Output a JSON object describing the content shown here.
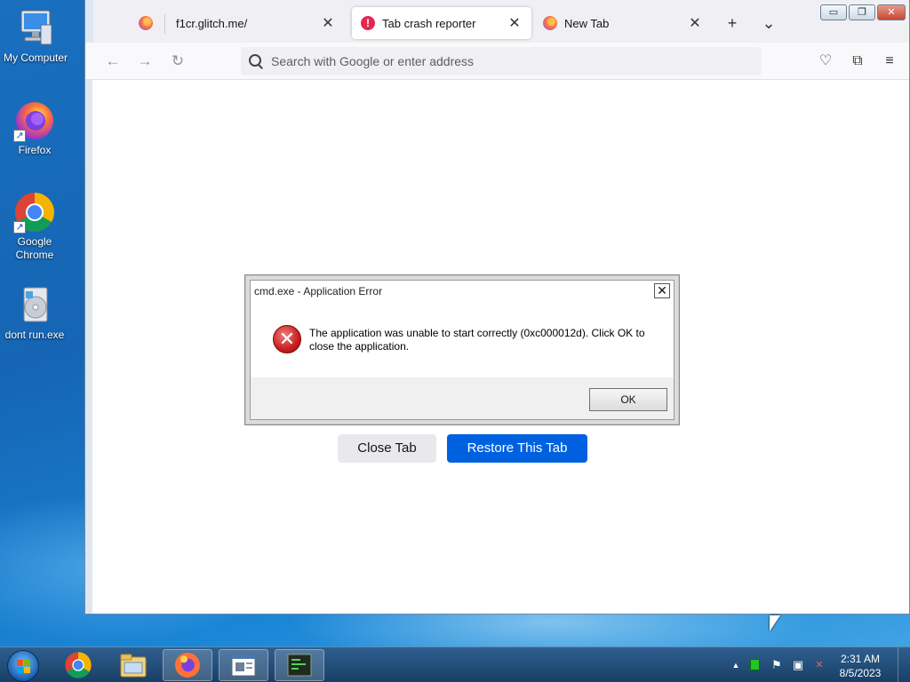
{
  "desktop": {
    "icons": [
      {
        "label": "My Computer",
        "icon": "computer-icon"
      },
      {
        "label": "Firefox",
        "icon": "firefox-icon"
      },
      {
        "label": "Google Chrome",
        "icon": "chrome-icon"
      },
      {
        "label": "dont run.exe",
        "icon": "installer-icon"
      }
    ]
  },
  "browser": {
    "tabs": [
      {
        "title": "",
        "icon": "firefox-icon"
      },
      {
        "title": "f1cr.glitch.me/",
        "close": "✕"
      },
      {
        "title": "Tab crash reporter",
        "icon": "warning-icon",
        "close": "✕",
        "active": true
      },
      {
        "title": "New Tab",
        "icon": "firefox-icon",
        "close": "✕"
      }
    ],
    "new_tab": "+",
    "list_tabs": "⌄",
    "window_controls": {
      "minimize": "▭",
      "restore": "❐",
      "close": "✕"
    },
    "nav": {
      "back": "←",
      "forward": "→",
      "reload": "↻"
    },
    "urlbar_placeholder": "Search with Google or enter address",
    "toolbar": {
      "pocket": "♡",
      "extensions": "⧉",
      "menu": "≡"
    },
    "crash_page": {
      "close_tab_label": "Close Tab",
      "restore_label": "Restore This Tab"
    }
  },
  "dialog": {
    "title": "cmd.exe - Application Error",
    "close": "✕",
    "message": "The application was unable to start correctly (0xc000012d). Click OK to close the application.",
    "ok_label": "OK",
    "icon": "error-icon"
  },
  "taskbar": {
    "items": [
      "chrome-icon",
      "explorer-icon",
      "firefox-icon",
      "notepad-icon",
      "cmd-icon"
    ],
    "tray": {
      "overflow": "▲",
      "flag": "⚑",
      "network": "▣",
      "volume": "✕"
    },
    "clock_time": "2:31 AM",
    "clock_date": "8/5/2023"
  },
  "colors": {
    "accent": "#0061e0",
    "error": "#c81e1e",
    "taskbar": "#183f66"
  }
}
